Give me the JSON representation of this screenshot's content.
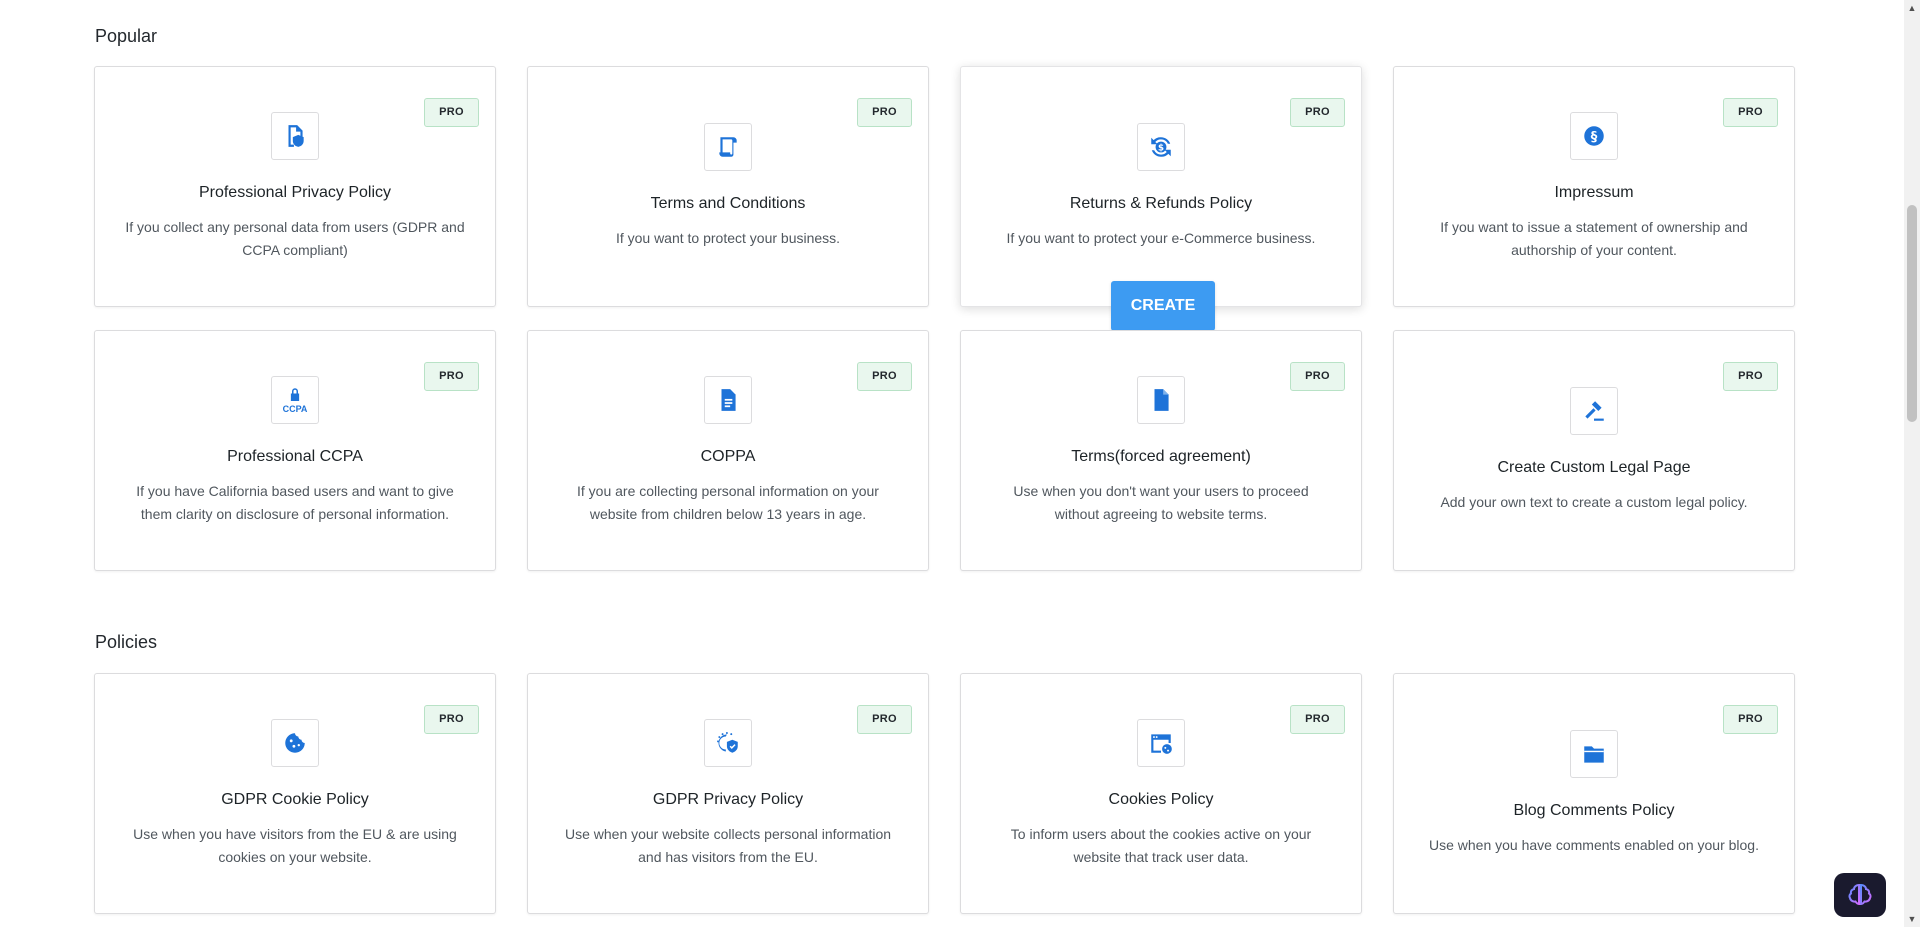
{
  "sections": [
    {
      "title": "Popular",
      "cards": [
        {
          "icon": "privacy-document-icon",
          "title": "Professional Privacy Policy",
          "desc": "If you collect any personal data from users (GDPR and CCPA compliant)",
          "badge": "PRO"
        },
        {
          "icon": "scroll-icon",
          "title": "Terms and Conditions",
          "desc": "If you want to protect your business.",
          "badge": "PRO"
        },
        {
          "icon": "dollar-refund-icon",
          "title": "Returns & Refunds Policy",
          "desc": "If you want to protect your e-Commerce business.",
          "badge": "PRO",
          "action": "CREATE"
        },
        {
          "icon": "section-sign-icon",
          "title": "Impressum",
          "desc": "If you want to issue a statement of ownership and authorship of your content.",
          "badge": "PRO"
        },
        {
          "icon": "ccpa-lock-icon",
          "icon_label": "CCPA",
          "title": "Professional CCPA",
          "desc": "If you have California based users and want to give them clarity on disclosure of personal information.",
          "badge": "PRO"
        },
        {
          "icon": "document-icon",
          "title": "COPPA",
          "desc": "If you are collecting personal information on your website from children below 13 years in age.",
          "badge": "PRO"
        },
        {
          "icon": "file-icon",
          "title": "Terms(forced agreement)",
          "desc": "Use when you don't want your users to proceed without agreeing to website terms.",
          "badge": "PRO"
        },
        {
          "icon": "gavel-icon",
          "title": "Create Custom Legal Page",
          "desc": "Add your own text to create a custom legal policy.",
          "badge": "PRO"
        }
      ]
    },
    {
      "title": "Policies",
      "cards": [
        {
          "icon": "cookie-icon",
          "title": "GDPR Cookie Policy",
          "desc": "Use when you have visitors from the EU & are using cookies on your website.",
          "badge": "PRO"
        },
        {
          "icon": "globe-shield-icon",
          "title": "GDPR Privacy Policy",
          "desc": "Use when your website collects personal information and has visitors from the EU.",
          "badge": "PRO"
        },
        {
          "icon": "browser-cookie-icon",
          "title": "Cookies Policy",
          "desc": "To inform users about the cookies active on your website that track user data.",
          "badge": "PRO"
        },
        {
          "icon": "folder-icon",
          "title": "Blog Comments Policy",
          "desc": "Use when you have comments enabled on your blog.",
          "badge": "PRO"
        }
      ]
    }
  ],
  "colors": {
    "accent": "#1e73d8",
    "button": "#3d9bf2",
    "pro_bg": "#e9f7ee"
  }
}
